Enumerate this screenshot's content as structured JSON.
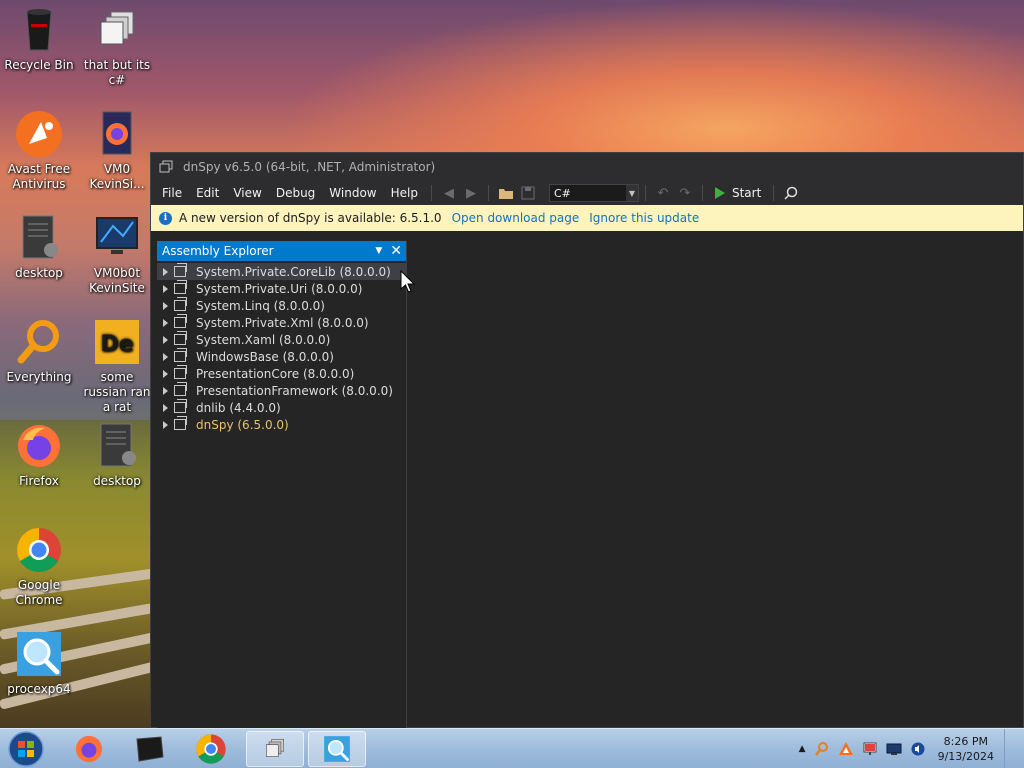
{
  "desktop": {
    "icons": [
      {
        "label": "Recycle Bin",
        "icon": "recycle-bin-icon"
      },
      {
        "label": "that but its c#",
        "icon": "copy-windows-icon"
      },
      {
        "label": "Avast Free Antivirus",
        "icon": "avast-icon"
      },
      {
        "label": "VM0 KevinSi...",
        "icon": "firefox-file-icon"
      },
      {
        "label": "desktop",
        "icon": "desktop-file-icon"
      },
      {
        "label": "VM0b0t KevinSite",
        "icon": "monitor-icon"
      },
      {
        "label": "Everything",
        "icon": "everything-search-icon"
      },
      {
        "label": "some russian ran a rat",
        "icon": "de-app-icon"
      },
      {
        "label": "Firefox",
        "icon": "firefox-icon"
      },
      {
        "label": "desktop",
        "icon": "desktop-file-icon"
      },
      {
        "label": "Google Chrome",
        "icon": "chrome-icon"
      },
      {
        "label": "procexp64",
        "icon": "procexp-icon"
      }
    ]
  },
  "window": {
    "title": "dnSpy v6.5.0 (64-bit, .NET, Administrator)",
    "menu": [
      "File",
      "Edit",
      "View",
      "Debug",
      "Window",
      "Help"
    ],
    "toolbar": {
      "language": "C#",
      "start_label": "Start"
    },
    "infobar": {
      "message": "A new version of dnSpy is available: 6.5.1.0",
      "download_link": "Open download page",
      "ignore_link": "Ignore this update"
    },
    "explorer": {
      "title": "Assembly Explorer",
      "assemblies": [
        "System.Private.CoreLib (8.0.0.0)",
        "System.Private.Uri (8.0.0.0)",
        "System.Linq (8.0.0.0)",
        "System.Private.Xml (8.0.0.0)",
        "System.Xaml (8.0.0.0)",
        "WindowsBase (8.0.0.0)",
        "PresentationCore (8.0.0.0)",
        "PresentationFramework (8.0.0.0)",
        "dnlib (4.4.0.0)",
        "dnSpy (6.5.0.0)"
      ]
    }
  },
  "taskbar": {
    "clock_time": "8:26 PM",
    "clock_date": "9/13/2024"
  },
  "colors": {
    "accent": "#007acc",
    "infobar_bg": "#fcf3bd",
    "start_green": "#3cb043",
    "dnspy_highlight": "#e8c06a"
  }
}
